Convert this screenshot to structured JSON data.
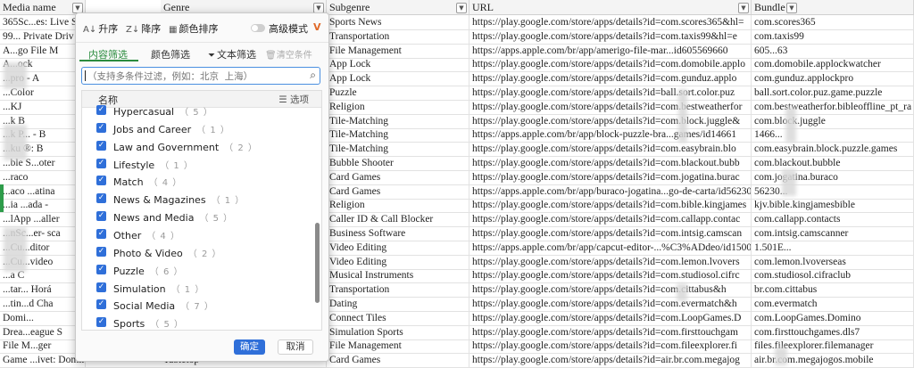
{
  "columns": [
    "Media name",
    "Genre",
    "Subgenre",
    "URL",
    "Bundle"
  ],
  "rows": [
    {
      "media": "365Sc...es: Live S",
      "genre": "",
      "subgenre": "Sports News",
      "url": "https://play.google.com/store/apps/details?id=com.scores365&hl=",
      "bundle": "com.scores365"
    },
    {
      "media": "99... Private Driv",
      "genre": "",
      "subgenre": "Transportation",
      "url": "https://play.google.com/store/apps/details?id=com.taxis99&hl=e",
      "bundle": "com.taxis99"
    },
    {
      "media": "A...go File M",
      "genre": "",
      "subgenre": "File Management",
      "url": "https://apps.apple.com/br/app/amerigo-file-mar...id605569660",
      "bundle": "605...63"
    },
    {
      "media": "A...ock",
      "genre": "",
      "subgenre": "App Lock",
      "url": "https://play.google.com/store/apps/details?id=com.domobile.applo",
      "bundle": "com.domobile.applockwatcher"
    },
    {
      "media": "...pro - A",
      "genre": "",
      "subgenre": "App Lock",
      "url": "https://play.google.com/store/apps/details?id=com.gunduz.applo",
      "bundle": "com.gunduz.applockpro"
    },
    {
      "media": "...Color",
      "genre": "",
      "subgenre": "Puzzle",
      "url": "https://play.google.com/store/apps/details?id=ball.sort.color.puz",
      "bundle": "ball.sort.color.puz.game.puzzle"
    },
    {
      "media": "...KJ",
      "genre": "",
      "subgenre": "Religion",
      "url": "https://play.google.com/store/apps/details?id=com.bestweatherfor",
      "bundle": "com.bestweatherfor.bibleoffline_pt_ra"
    },
    {
      "media": "...k B",
      "genre": "",
      "subgenre": "Tile-Matching",
      "url": "https://play.google.com/store/apps/details?id=com.block.juggle&",
      "bundle": "com.block.juggle"
    },
    {
      "media": "...k P... - B",
      "genre": "",
      "subgenre": "Tile-Matching",
      "url": "https://apps.apple.com/br/app/block-puzzle-bra...games/id14661",
      "bundle": "1466..."
    },
    {
      "media": "...ku ®: B",
      "genre": "",
      "subgenre": "Tile-Matching",
      "url": "https://play.google.com/store/apps/details?id=com.easybrain.blo",
      "bundle": "com.easybrain.block.puzzle.games"
    },
    {
      "media": "...ble S...oter",
      "genre": "",
      "subgenre": "Bubble Shooter",
      "url": "https://play.google.com/store/apps/details?id=com.blackout.bubb",
      "bundle": "com.blackout.bubble"
    },
    {
      "media": "...raco",
      "genre": "",
      "subgenre": "Card Games",
      "url": "https://play.google.com/store/apps/details?id=com.jogatina.burac",
      "bundle": "com.jogatina.buraco"
    },
    {
      "media": "...aco ...atina",
      "genre": "",
      "subgenre": "Card Games",
      "url": "https://apps.apple.com/br/app/buraco-jogatina...go-de-carta/id56230",
      "bundle": "56230..."
    },
    {
      "media": "...ia ...ada -",
      "genre": "",
      "subgenre": "Religion",
      "url": "https://play.google.com/store/apps/details?id=com.bible.kingjames",
      "bundle": "kjv.bible.kingjamesbible"
    },
    {
      "media": "...lApp ...aller",
      "genre": "",
      "subgenre": "Caller ID & Call Blocker",
      "url": "https://play.google.com/store/apps/details?id=com.callapp.contac",
      "bundle": "com.callapp.contacts"
    },
    {
      "media": "...nSc...er- sca",
      "genre": "",
      "subgenre": "Business Software",
      "url": "https://play.google.com/store/apps/details?id=com.intsig.camscan",
      "bundle": "com.intsig.camscanner"
    },
    {
      "media": "...Cu...ditor",
      "genre": "",
      "subgenre": "Video Editing",
      "url": "https://apps.apple.com/br/app/capcut-editor-...%C3%ADdeo/id1500",
      "bundle": "1.501E..."
    },
    {
      "media": "...Cu...video",
      "genre": "",
      "subgenre": "Video Editing",
      "url": "https://play.google.com/store/apps/details?id=com.lemon.lvovers",
      "bundle": "com.lemon.lvoverseas"
    },
    {
      "media": "...a C",
      "genre": "",
      "subgenre": "Musical Instruments",
      "url": "https://play.google.com/store/apps/details?id=com.studiosol.cifrc",
      "bundle": "com.studiosol.cifraclub"
    },
    {
      "media": "...tar... Horá",
      "genre": "",
      "subgenre": "Transportation",
      "url": "https://play.google.com/store/apps/details?id=com.cittabus&h",
      "bundle": "br.com.cittabus"
    },
    {
      "media": "...tin...d Cha",
      "genre": "",
      "subgenre": "Dating",
      "url": "https://play.google.com/store/apps/details?id=com.evermatch&h",
      "bundle": "com.evermatch"
    },
    {
      "media": "Domi...",
      "genre": "",
      "subgenre": "Connect Tiles",
      "url": "https://play.google.com/store/apps/details?id=com.LoopGames.D",
      "bundle": "com.LoopGames.Domino"
    },
    {
      "media": "Drea...eague S",
      "genre": "",
      "subgenre": "Simulation Sports",
      "url": "https://play.google.com/store/apps/details?id=com.firsttouchgam",
      "bundle": "com.firsttouchgames.dls7"
    },
    {
      "media": "File M...ger",
      "genre": "",
      "subgenre": "File Management",
      "url": "https://play.google.com/store/apps/details?id=com.fileexplorer.fi",
      "bundle": "files.fileexplorer.filemanager"
    },
    {
      "media": "Game ...ivet: Domino, Spades",
      "genre": "Tabletop",
      "subgenre": "Card Games",
      "url": "https://play.google.com/store/apps/details?id=air.br.com.megajog",
      "bundle": "air.br.com.megajogos.mobile"
    }
  ],
  "toolbar": {
    "sort_asc": "升序",
    "sort_desc": "降序",
    "color_sort": "颜色排序",
    "advanced_mode": "高级模式"
  },
  "tabs": {
    "content_filter": "内容筛选",
    "color_filter": "颜色筛选",
    "text_filter": "文本筛选",
    "clear": "清空条件"
  },
  "search": {
    "placeholder": "（支持多条件过滤，例如：北京  上海）"
  },
  "list": {
    "header_name": "名称",
    "header_options": "选项",
    "items": [
      {
        "label": "Hypercasual",
        "count": "（ 5 ）"
      },
      {
        "label": "Jobs and Career",
        "count": "（ 1 ）"
      },
      {
        "label": "Law and Government",
        "count": "（ 2 ）"
      },
      {
        "label": "Lifestyle",
        "count": "（ 1 ）"
      },
      {
        "label": "Match",
        "count": "（ 4 ）"
      },
      {
        "label": "News & Magazines",
        "count": "（ 1 ）"
      },
      {
        "label": "News and Media",
        "count": "（ 5 ）"
      },
      {
        "label": "Other",
        "count": "（ 4 ）"
      },
      {
        "label": "Photo & Video",
        "count": "（ 2 ）"
      },
      {
        "label": "Puzzle",
        "count": "（ 6 ）"
      },
      {
        "label": "Simulation",
        "count": "（ 1 ）"
      },
      {
        "label": "Social Media",
        "count": "（ 7 ）"
      },
      {
        "label": "Sports",
        "count": "（ 5 ）"
      }
    ]
  },
  "buttons": {
    "ok": "确定",
    "cancel": "取消"
  },
  "colors": {
    "accent_blue": "#2f6fd9",
    "tab_green": "#2b8c3e"
  }
}
